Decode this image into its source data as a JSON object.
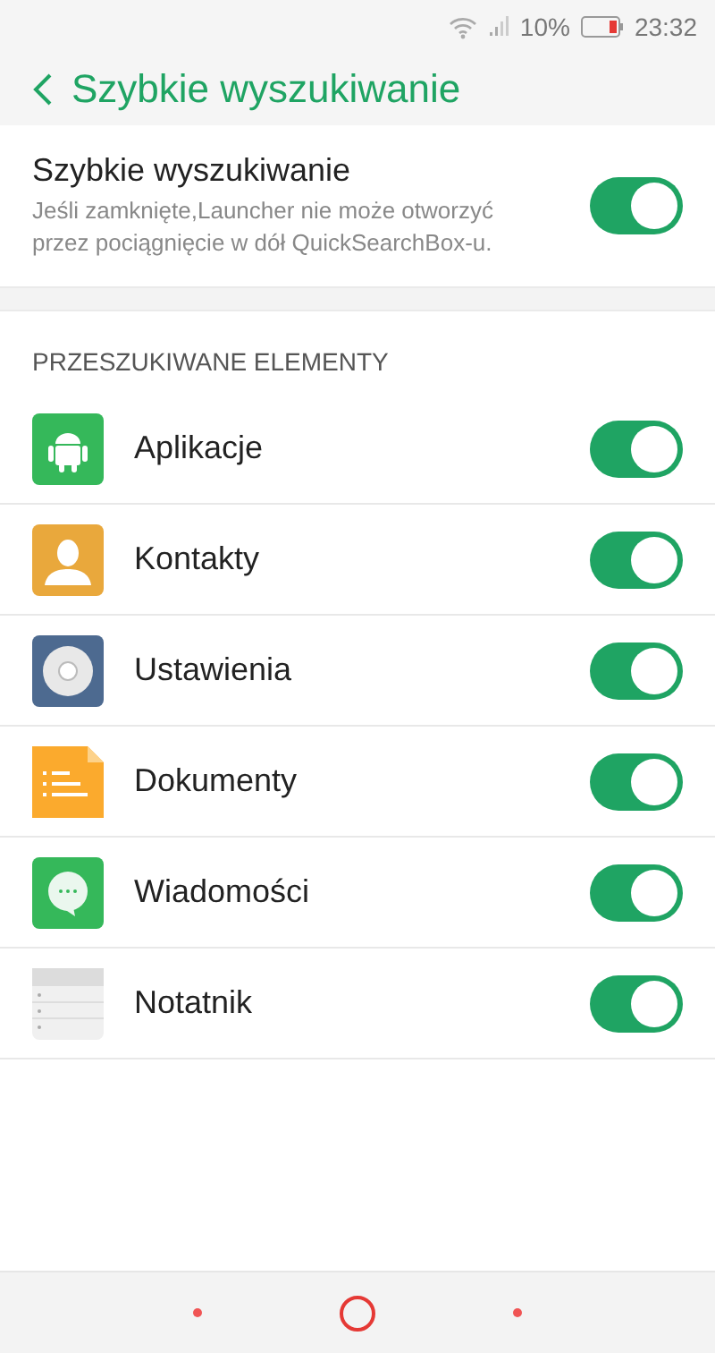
{
  "status_bar": {
    "battery_text": "10%",
    "time": "23:32"
  },
  "header": {
    "title": "Szybkie wyszukiwanie"
  },
  "main_setting": {
    "title": "Szybkie wyszukiwanie",
    "description": "Jeśli zamknięte,Launcher nie może otworzyć przez pociągnięcie w dół QuickSearchBox-u.",
    "on": true
  },
  "section": {
    "title": "PRZESZUKIWANE ELEMENTY"
  },
  "items": [
    {
      "kind": "apps",
      "label": "Aplikacje",
      "on": true
    },
    {
      "kind": "contacts",
      "label": "Kontakty",
      "on": true
    },
    {
      "kind": "settings",
      "label": "Ustawienia",
      "on": true
    },
    {
      "kind": "documents",
      "label": "Dokumenty",
      "on": true
    },
    {
      "kind": "messages",
      "label": "Wiadomości",
      "on": true
    },
    {
      "kind": "notes",
      "label": "Notatnik",
      "on": true
    }
  ]
}
